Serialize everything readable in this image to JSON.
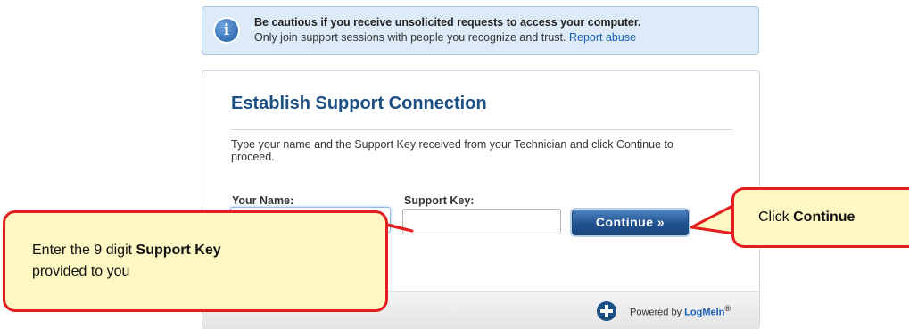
{
  "banner": {
    "icon": "info-icon",
    "title": "Be cautious if you receive unsolicited requests to access your computer.",
    "text": "Only join support sessions with people you recognize and trust.",
    "link": "Report abuse"
  },
  "panel": {
    "title": "Establish Support Connection",
    "instructions": "Type your name and the Support Key received from your Technician and click Continue to proceed.",
    "name_label": "Your Name:",
    "name_value": "",
    "key_label": "Support Key:",
    "key_value": "",
    "continue_label": "Continue »"
  },
  "footer": {
    "powered_by": "Powered by",
    "brand": "LogMeIn",
    "reg_mark": "®"
  },
  "callouts": {
    "left_prefix": "Enter the 9 digit",
    "left_bold": "Support Key",
    "left_suffix": "provided to you",
    "right_prefix": "Click",
    "right_bold": "Continue"
  },
  "colors": {
    "accent": "#1c4f84",
    "link": "#1a5fb4",
    "callout_fill": "#fdf7c3",
    "callout_border": "#e21e1e",
    "banner_bg": "#dcebf7"
  }
}
